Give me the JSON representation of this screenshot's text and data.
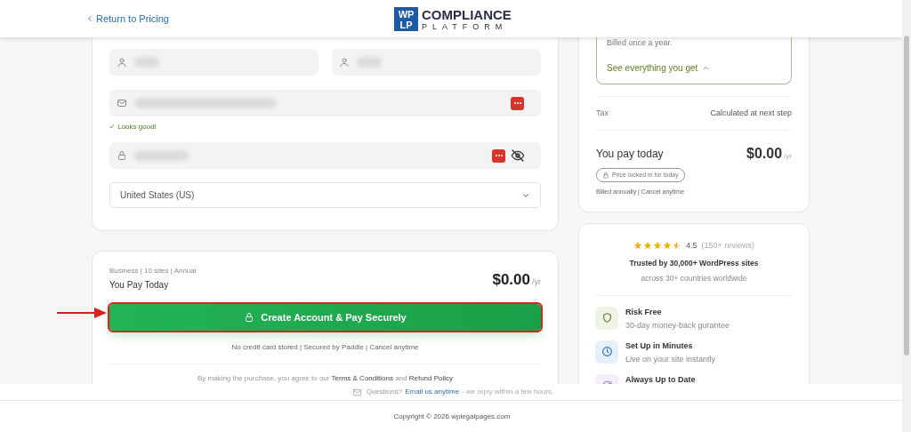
{
  "header": {
    "back_link": "Return to Pricing",
    "logo": {
      "mark_top": "WP",
      "mark_bottom": "LP",
      "title": "COMPLIANCE",
      "subtitle": "PLATFORM"
    }
  },
  "form": {
    "fields": [
      {
        "kind": "name"
      },
      {
        "kind": "name"
      },
      {
        "kind": "email",
        "autofill_badge": true
      },
      {
        "kind": "password",
        "autofill_badge": true,
        "reveal": true
      }
    ],
    "validation": "✓ Looks good!",
    "country": "United States (US)"
  },
  "checkout": {
    "plan": "Business | 10 sites | Annual",
    "label": "You Pay Today",
    "price": "$0.00",
    "period": "/yr",
    "button": "Create Account & Pay Securely",
    "note": "No credit card stored | Secured by Paddle | Cancel anytime",
    "legal": "By making the purchase, you agree to our **Terms & Conditions** and **Refund Policy**"
  },
  "summary": {
    "billed": "Billed once a year.",
    "see_all": "See everything you get",
    "expanded": true,
    "tax_label": "Tax",
    "tax_value": "Calculated at next step",
    "pay_label": "You pay today",
    "price": "$0.00",
    "period": "/yr",
    "lock_badge": "Price locked in for today",
    "billing_note": "Billed annually | Cancel anytime"
  },
  "trust": {
    "stars": 4.5,
    "rating": "4.5",
    "reviews": "(150+ reviews)",
    "headline": "Trusted by 30,000+ WordPress sites",
    "subline": "across 30+ countries worldwide",
    "features": [
      {
        "kind": "shield",
        "title": "Risk Free",
        "text": "30-day money-back gurantee"
      },
      {
        "kind": "clock",
        "title": "Set Up in Minutes",
        "text": "Live on your site instantly"
      },
      {
        "kind": "refresh",
        "title": "Always Up to Date"
      }
    ]
  },
  "footer": {
    "question": "Questions?",
    "email_link": "Email us anytime",
    "reply": "- we reply within a few hours.",
    "copyright": "Copyright © 2026 wplegalpages.com"
  }
}
